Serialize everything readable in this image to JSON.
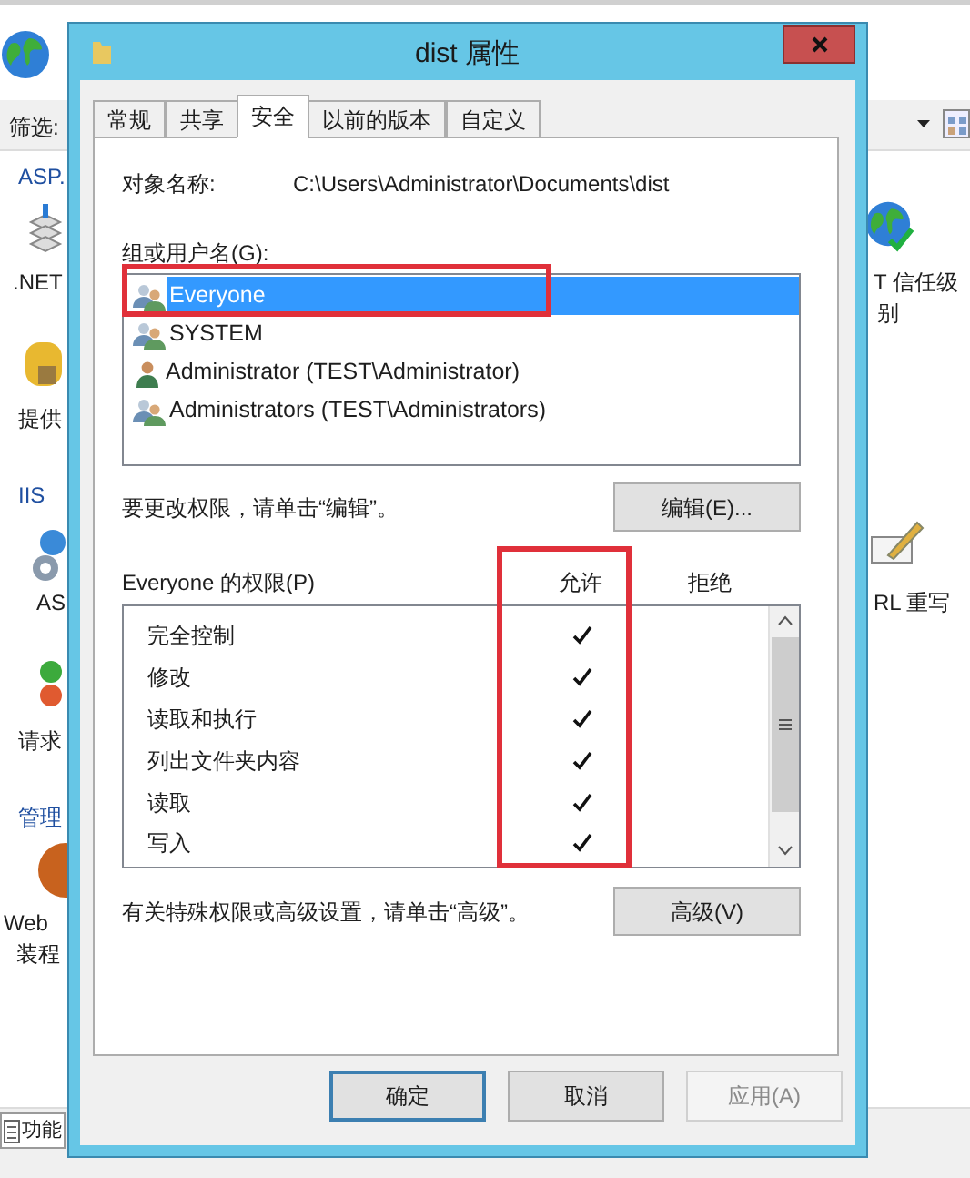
{
  "background": {
    "filter_label": "筛选:",
    "left_items": [
      {
        "text": "ASP.",
        "kind": "heading"
      },
      {
        "text": ".NET",
        "kind": "item"
      },
      {
        "text": "提供",
        "kind": "item"
      },
      {
        "text": "IIS",
        "kind": "heading"
      },
      {
        "text": "AS",
        "kind": "item"
      },
      {
        "text": "请求",
        "kind": "item"
      },
      {
        "text": "管理",
        "kind": "heading"
      },
      {
        "text": "Web",
        "kind": "item"
      },
      {
        "text": "装程",
        "kind": "item"
      }
    ],
    "right_items": [
      {
        "text": "T 信任级"
      },
      {
        "text": "别"
      },
      {
        "text": "RL 重写"
      }
    ],
    "status_tab": "功能"
  },
  "dialog": {
    "title": "dist 属性",
    "tabs": [
      {
        "label": "常规",
        "selected": false
      },
      {
        "label": "共享",
        "selected": false
      },
      {
        "label": "安全",
        "selected": true
      },
      {
        "label": "以前的版本",
        "selected": false
      },
      {
        "label": "自定义",
        "selected": false
      }
    ],
    "object_name_label": "对象名称:",
    "object_name": "C:\\Users\\Administrator\\Documents\\dist",
    "users_label": "组或用户名(G):",
    "users": [
      {
        "name": "Everyone",
        "kind": "group",
        "selected": true
      },
      {
        "name": "SYSTEM",
        "kind": "group",
        "selected": false
      },
      {
        "name": "Administrator (TEST\\Administrator)",
        "kind": "user",
        "selected": false
      },
      {
        "name": "Administrators (TEST\\Administrators)",
        "kind": "group",
        "selected": false
      }
    ],
    "edit_hint": "要更改权限，请单击“编辑”。",
    "edit_button": "编辑(E)...",
    "permissions_label": "Everyone 的权限(P)",
    "columns": [
      "允许",
      "拒绝"
    ],
    "permissions": [
      {
        "name": "完全控制",
        "allow": true,
        "deny": false
      },
      {
        "name": "修改",
        "allow": true,
        "deny": false
      },
      {
        "name": "读取和执行",
        "allow": true,
        "deny": false
      },
      {
        "name": "列出文件夹内容",
        "allow": true,
        "deny": false
      },
      {
        "name": "读取",
        "allow": true,
        "deny": false
      },
      {
        "name": "写入",
        "allow": true,
        "deny": false
      }
    ],
    "advanced_hint": "有关特殊权限或高级设置，请单击“高级”。",
    "advanced_button": "高级(V)",
    "buttons": [
      {
        "label": "确定",
        "kind": "default",
        "disabled": false
      },
      {
        "label": "取消",
        "kind": "normal",
        "disabled": false
      },
      {
        "label": "应用(A)",
        "kind": "normal",
        "disabled": true
      }
    ]
  }
}
